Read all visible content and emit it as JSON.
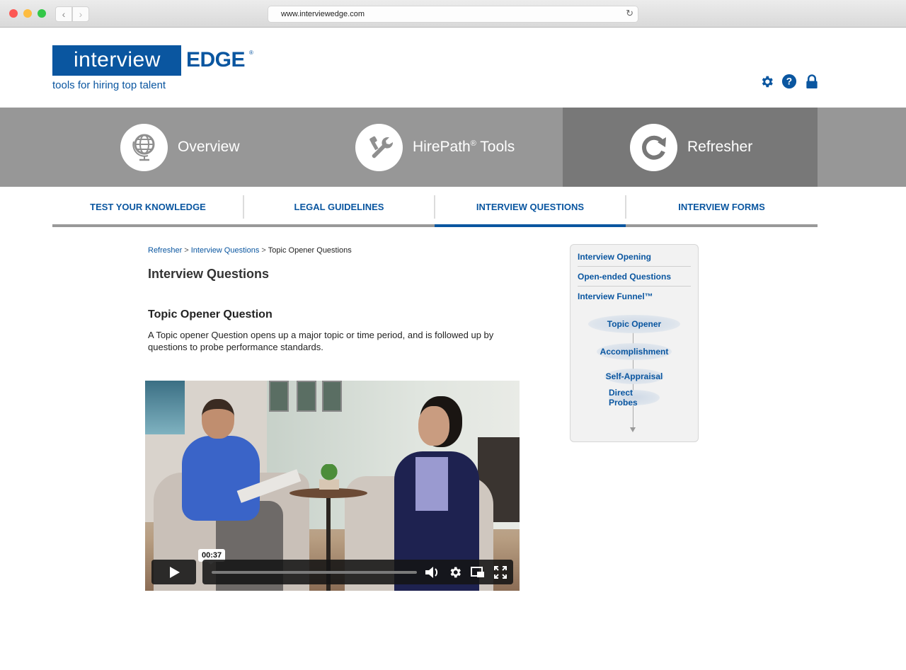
{
  "browser": {
    "url": "www.interviewedge.com",
    "back_icon": "chevron-left-icon",
    "forward_icon": "chevron-right-icon",
    "reload_icon": "reload-icon"
  },
  "header": {
    "logo_word": "interview",
    "logo_edge": "EDGE",
    "logo_registered": "®",
    "tagline": "tools for hiring top talent",
    "icons": [
      "gear-icon",
      "help-icon",
      "lock-icon"
    ]
  },
  "main_nav": {
    "items": [
      {
        "label": "Overview",
        "icon": "globe-icon",
        "active": false
      },
      {
        "label": "HirePath",
        "sup": "®",
        "label_suffix": " Tools",
        "icon": "tools-icon",
        "active": false
      },
      {
        "label": "Refresher",
        "icon": "refresh-icon",
        "active": true
      }
    ]
  },
  "sub_tabs": [
    {
      "label": "TEST YOUR KNOWLEDGE",
      "active": false
    },
    {
      "label": "LEGAL GUIDELINES",
      "active": false
    },
    {
      "label": "INTERVIEW QUESTIONS",
      "active": true
    },
    {
      "label": "INTERVIEW FORMS",
      "active": false
    }
  ],
  "breadcrumb": {
    "items": [
      "Refresher",
      "Interview Questions"
    ],
    "separator": ">",
    "current": "Topic Opener Questions"
  },
  "content": {
    "page_title": "Interview Questions",
    "section_title": "Topic Opener Question",
    "section_body": "A Topic opener Question opens up a major topic or time period, and is followed up by questions to probe performance standards."
  },
  "video": {
    "hover_time": "00:37",
    "progress_fraction": 0.0,
    "controls": [
      "play-icon",
      "volume-icon",
      "settings-icon",
      "pip-icon",
      "fullscreen-icon"
    ]
  },
  "sidebar": {
    "links": [
      "Interview Opening",
      "Open-ended Questions",
      "Interview Funnel™"
    ],
    "funnel_steps": [
      "Topic Opener",
      "Accomplishment",
      "Self-Appraisal",
      "Direct Probes"
    ]
  },
  "colors": {
    "brand_blue": "#0a56a0",
    "nav_gray": "#979797",
    "nav_active": "#787878",
    "tab_bar_gray": "#999999"
  }
}
